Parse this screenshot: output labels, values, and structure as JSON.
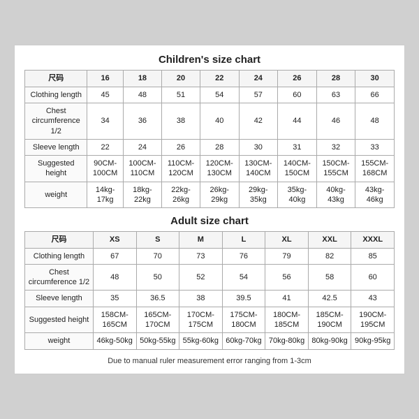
{
  "children_chart": {
    "title": "Children's size chart",
    "columns": [
      "尺码",
      "16",
      "18",
      "20",
      "22",
      "24",
      "26",
      "28",
      "30"
    ],
    "rows": [
      {
        "label": "Clothing length",
        "values": [
          "45",
          "48",
          "51",
          "54",
          "57",
          "60",
          "63",
          "66"
        ]
      },
      {
        "label": "Chest circumference 1/2",
        "values": [
          "34",
          "36",
          "38",
          "40",
          "42",
          "44",
          "46",
          "48"
        ]
      },
      {
        "label": "Sleeve length",
        "values": [
          "22",
          "24",
          "26",
          "28",
          "30",
          "31",
          "32",
          "33"
        ]
      },
      {
        "label": "Suggested height",
        "values": [
          "90CM-100CM",
          "100CM-110CM",
          "110CM-120CM",
          "120CM-130CM",
          "130CM-140CM",
          "140CM-150CM",
          "150CM-155CM",
          "155CM-168CM"
        ]
      },
      {
        "label": "weight",
        "values": [
          "14kg-17kg",
          "18kg-22kg",
          "22kg-26kg",
          "26kg-29kg",
          "29kg-35kg",
          "35kg-40kg",
          "40kg-43kg",
          "43kg-46kg"
        ]
      }
    ]
  },
  "adult_chart": {
    "title": "Adult size chart",
    "columns": [
      "尺码",
      "XS",
      "S",
      "M",
      "L",
      "XL",
      "XXL",
      "XXXL"
    ],
    "rows": [
      {
        "label": "Clothing length",
        "values": [
          "67",
          "70",
          "73",
          "76",
          "79",
          "82",
          "85"
        ]
      },
      {
        "label": "Chest circumference 1/2",
        "values": [
          "48",
          "50",
          "52",
          "54",
          "56",
          "58",
          "60"
        ]
      },
      {
        "label": "Sleeve length",
        "values": [
          "35",
          "36.5",
          "38",
          "39.5",
          "41",
          "42.5",
          "43"
        ]
      },
      {
        "label": "Suggested height",
        "values": [
          "158CM-165CM",
          "165CM-170CM",
          "170CM-175CM",
          "175CM-180CM",
          "180CM-185CM",
          "185CM-190CM",
          "190CM-195CM"
        ]
      },
      {
        "label": "weight",
        "values": [
          "46kg-50kg",
          "50kg-55kg",
          "55kg-60kg",
          "60kg-70kg",
          "70kg-80kg",
          "80kg-90kg",
          "90kg-95kg"
        ]
      }
    ]
  },
  "note": "Due to manual ruler measurement error ranging from 1-3cm"
}
